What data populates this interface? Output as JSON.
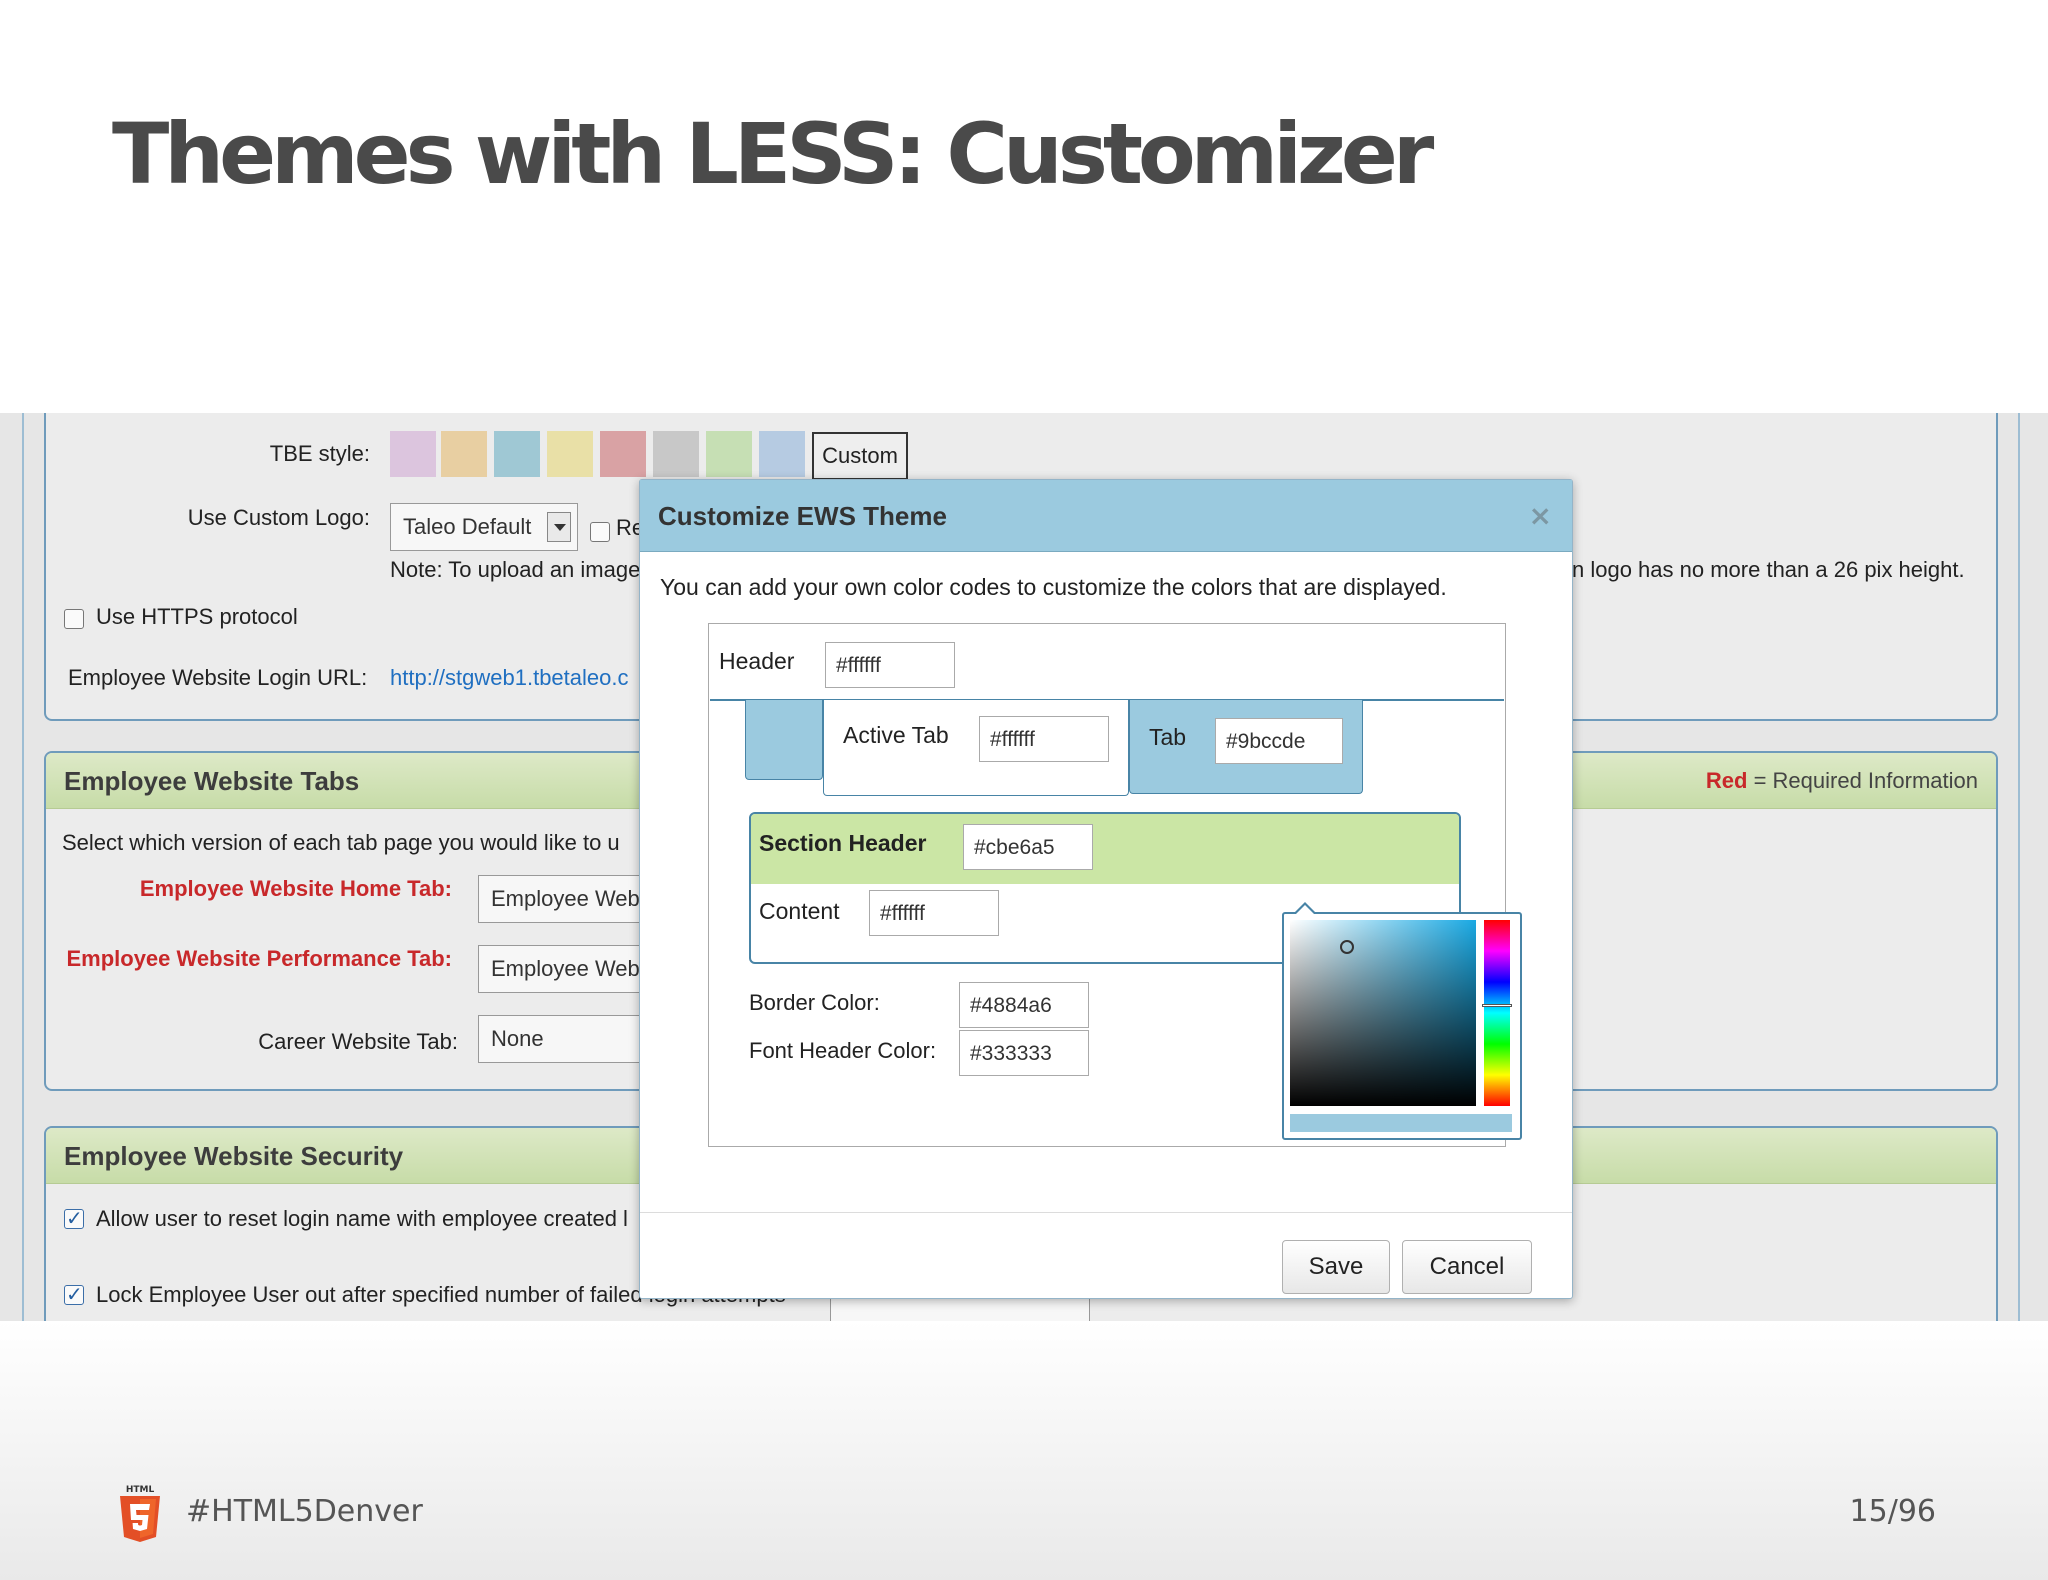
{
  "slide": {
    "title": "Themes with LESS: Customizer",
    "hashtag": "#HTML5Denver",
    "page": "15/96",
    "logo": "html5-logo-icon"
  },
  "settings": {
    "tbe_label": "TBE style:",
    "swatches": [
      "#dcc5de",
      "#e8cfa2",
      "#9fc8d4",
      "#e9e0a7",
      "#d9a2a4",
      "#c8c8c8",
      "#c6dfb4",
      "#b6cbe2"
    ],
    "custom_label": "Custom",
    "logo_label": "Use Custom Logo:",
    "logo_select": "Taleo Default",
    "logo_check_label": "Re",
    "note": "Note: To upload an image",
    "note_right": "n logo has no more than a 26 pix height.",
    "https_label": "Use HTTPS protocol",
    "login_url_label": "Employee Website Login URL:",
    "login_url": "http://stgweb1.tbetaleo.c"
  },
  "tabs_panel": {
    "title": "Employee Website Tabs",
    "required_red": "Red",
    "required_rest": " = Required Information",
    "intro": "Select which version of each tab page you would like to u",
    "home_label": "Employee Website Home Tab:",
    "home_value": "Employee Web",
    "perf_label": "Employee Website Performance Tab:",
    "perf_value": "Employee Web",
    "career_label": "Career Website Tab:",
    "career_value": "None"
  },
  "security_panel": {
    "title": "Employee Website Security",
    "reset_label": "Allow user to reset login name with employee created l",
    "lock_label": "Lock Employee User out after specified number of failed login attempts"
  },
  "modal": {
    "title": "Customize EWS Theme",
    "close": "×",
    "description": "You can add your own color codes to customize the colors that are displayed.",
    "header_label": "Header",
    "header_value": "#ffffff",
    "active_tab_label": "Active Tab",
    "active_tab_value": "#ffffff",
    "tab_label": "Tab",
    "tab_value": "#9bccde",
    "section_header_label": "Section Header",
    "section_header_value": "#cbe6a5",
    "content_label": "Content",
    "content_value": "#ffffff",
    "border_label": "Border Color:",
    "border_value": "#4884a6",
    "font_header_label": "Font Header Color:",
    "font_header_value": "#333333",
    "save": "Save",
    "cancel": "Cancel"
  }
}
